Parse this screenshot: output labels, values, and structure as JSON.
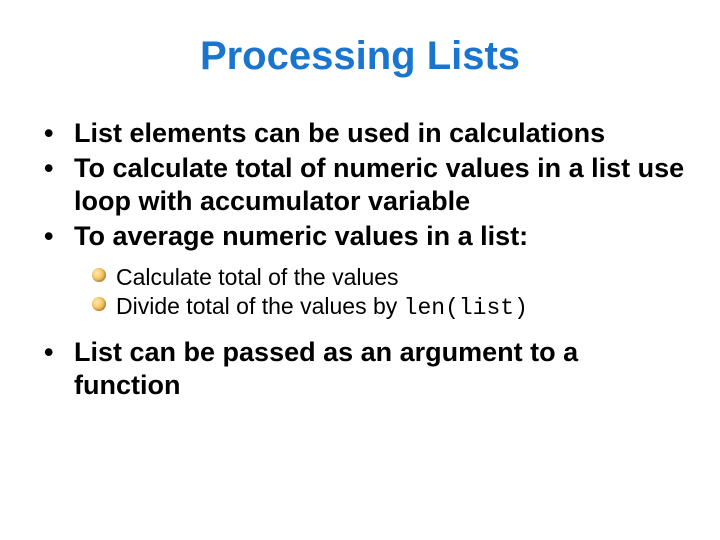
{
  "title": "Processing Lists",
  "bullets": {
    "b1": "List elements can be used in calculations",
    "b2": "To calculate total of numeric values in a list use loop with accumulator variable",
    "b3": "To average numeric values in a list:",
    "b4": "List can be passed as an argument to a function"
  },
  "sub": {
    "s1": "Calculate total of the values",
    "s2_prefix": "Divide total of the values by ",
    "s2_code": "len(list)"
  }
}
